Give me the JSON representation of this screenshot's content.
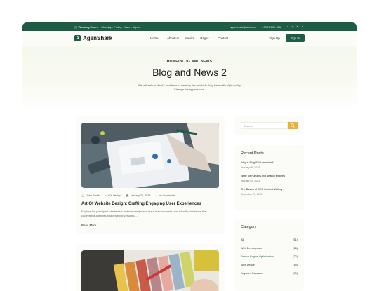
{
  "topbar": {
    "hours_label": "Working Hours",
    "hours_value": "- Monday - Friday, 10am - 05pm",
    "email": "agenshark@fact.com",
    "phone": "+0929 299 986"
  },
  "brand": {
    "name": "AgenShark",
    "logo_letter": "A"
  },
  "nav": {
    "items": [
      {
        "label": "Home",
        "dropdown": true
      },
      {
        "label": "About us",
        "dropdown": false
      },
      {
        "label": "Service",
        "dropdown": false
      },
      {
        "label": "Pages",
        "dropdown": true
      },
      {
        "label": "Contact",
        "dropdown": false
      }
    ],
    "signup": "Sign Up",
    "signin": "Sign In"
  },
  "hero": {
    "breadcrumb": "HOME/BLOG AND NEWS",
    "title": "Blog and News 2",
    "subtitle": "We will help a client's problems to develop the products they have with high quality Change the appearance."
  },
  "posts": [
    {
      "author": "John Smith",
      "category": "UX Design",
      "date": "January 25, 2024",
      "comments": "No Comments",
      "title": "Art Of Website Design: Crafting Engaging User Experiences",
      "excerpt": "Explore the principles of effective website design and learn how to create user-friendly interfaces that captivate audiences and drive conversions....",
      "read_more": "Read More"
    }
  ],
  "sidebar": {
    "search_placeholder": "Search",
    "recent_title": "Recent Posts",
    "recent_posts": [
      {
        "title": "Why is Blog SEO important?",
        "date": "January 05, 2024"
      },
      {
        "title": "Write for humans, not search engines",
        "date": "January 02, 2023"
      },
      {
        "title": "The Basics of SEO Content Writing",
        "date": "December 27, 2023"
      }
    ],
    "category_title": "Category",
    "categories": [
      {
        "name": "All",
        "count": "(61)"
      },
      {
        "name": "Web Development",
        "count": "(16)"
      },
      {
        "name": "Search Engine Optimization",
        "count": "(22)"
      },
      {
        "name": "Web Design",
        "count": "(14)"
      },
      {
        "name": "Keyword Research",
        "count": "(09)"
      }
    ]
  },
  "colors": {
    "brand_green": "#1f5c45",
    "accent_yellow": "#e8b23a"
  }
}
